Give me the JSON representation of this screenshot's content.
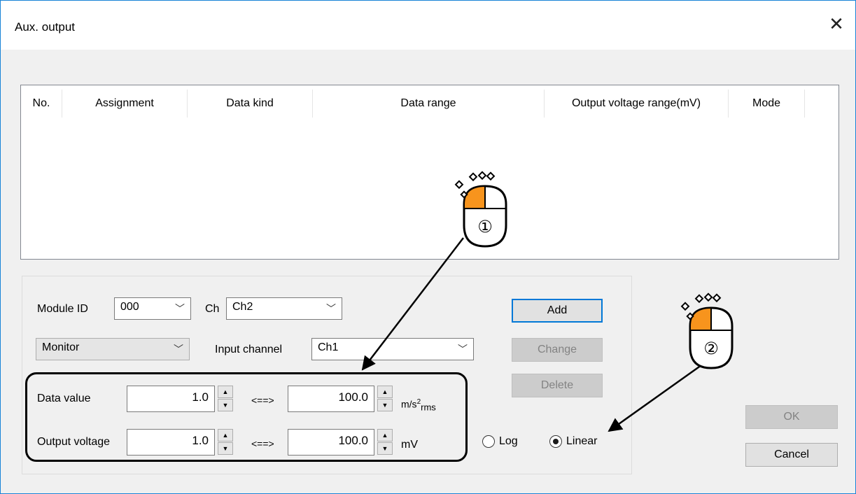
{
  "window": {
    "title": "Aux. output"
  },
  "list": {
    "columns": [
      "No.",
      "Assignment",
      "Data kind",
      "Data range",
      "Output voltage range(mV)",
      "Mode"
    ]
  },
  "form": {
    "module_id_label": "Module ID",
    "module_id_value": "000",
    "ch_label": "Ch",
    "ch_value": "Ch2",
    "type_value": "Monitor",
    "input_channel_label": "Input channel",
    "input_channel_value": "Ch1",
    "data_value_label": "Data value",
    "data_value_min": "1.0",
    "data_value_max": "100.0",
    "data_unit_main": "m/s",
    "data_unit_sup": "2",
    "data_unit_sub": "rms",
    "output_voltage_label": "Output voltage",
    "output_voltage_min": "1.0",
    "output_voltage_max": "100.0",
    "output_unit": "mV",
    "arrow_label": "<==>",
    "mode_log_label": "Log",
    "mode_linear_label": "Linear",
    "mode_selected": "Linear"
  },
  "buttons": {
    "add": "Add",
    "change": "Change",
    "delete": "Delete",
    "ok": "OK",
    "cancel": "Cancel"
  },
  "annotations": {
    "marker_1": "①",
    "marker_2": "②",
    "accent_color": "#f7941d"
  }
}
